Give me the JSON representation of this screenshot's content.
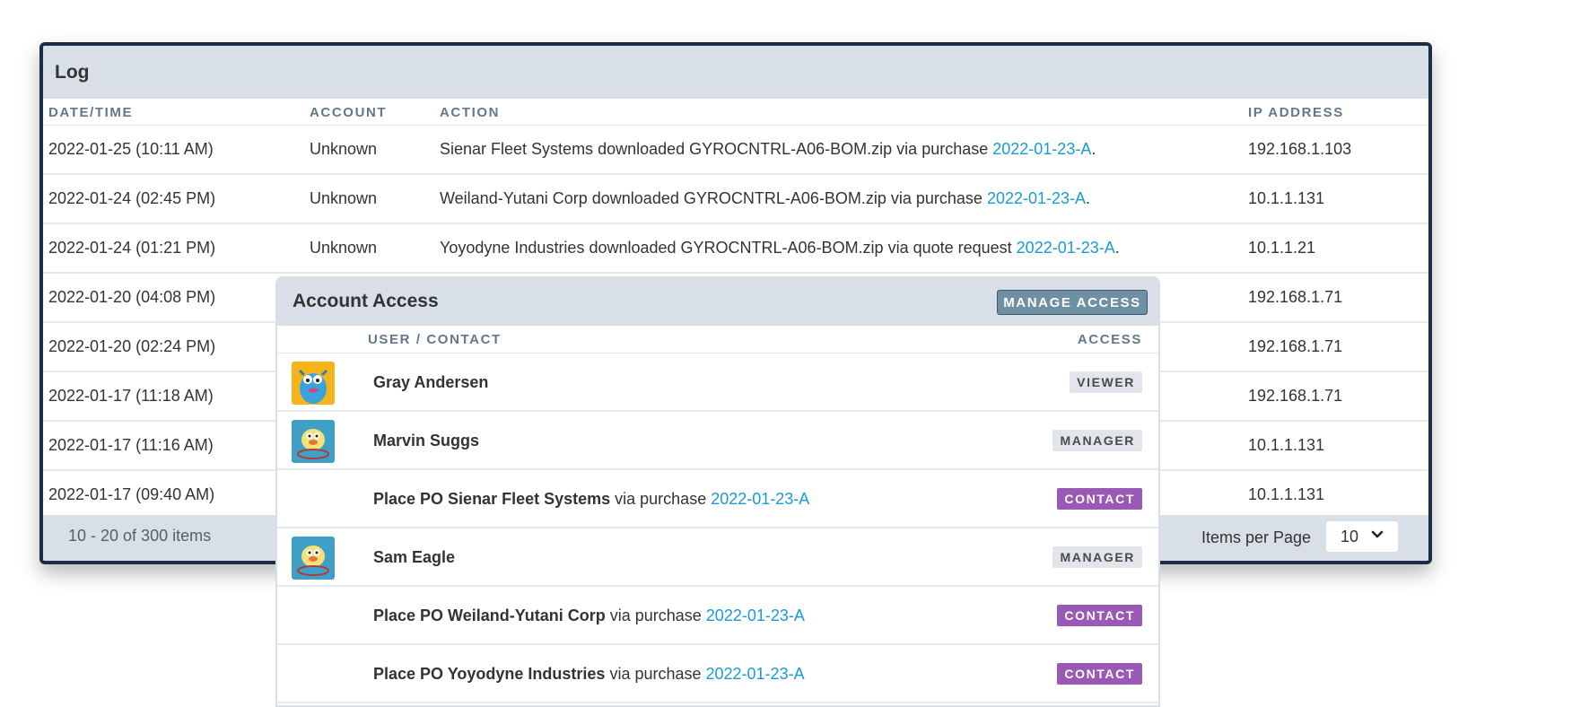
{
  "log": {
    "title": "Log",
    "columns": {
      "datetime": "DATE/TIME",
      "account": "ACCOUNT",
      "action": "ACTION",
      "ip": "IP ADDRESS"
    },
    "rows": [
      {
        "datetime": "2022-01-25 (10:11 AM)",
        "account": "Unknown",
        "action_text": "Sienar Fleet Systems downloaded GYROCNTRL-A06-BOM.zip via purchase ",
        "action_link": "2022-01-23-A",
        "action_tail": ".",
        "ip": "192.168.1.103"
      },
      {
        "datetime": "2022-01-24 (02:45 PM)",
        "account": "Unknown",
        "action_text": "Weiland-Yutani Corp downloaded GYROCNTRL-A06-BOM.zip via purchase ",
        "action_link": "2022-01-23-A",
        "action_tail": ".",
        "ip": "10.1.1.131"
      },
      {
        "datetime": "2022-01-24 (01:21 PM)",
        "account": "Unknown",
        "action_text": "Yoyodyne Industries downloaded GYROCNTRL-A06-BOM.zip via quote request ",
        "action_link": "2022-01-23-A",
        "action_tail": ".",
        "ip": "10.1.1.21"
      },
      {
        "datetime": "2022-01-20 (04:08 PM)",
        "ip": "192.168.1.71"
      },
      {
        "datetime": "2022-01-20 (02:24 PM)",
        "ip": "192.168.1.71"
      },
      {
        "datetime": "2022-01-17 (11:18 AM)",
        "ip": "192.168.1.71"
      },
      {
        "datetime": "2022-01-17 (11:16 AM)",
        "ip": "10.1.1.131"
      },
      {
        "datetime": "2022-01-17 (09:40 AM)",
        "ip": "10.1.1.131"
      }
    ],
    "footer": {
      "count_text": "10 - 20 of 300 items",
      "items_per_page_label": "Items per Page",
      "items_per_page_value": "10"
    }
  },
  "access": {
    "title": "Account Access",
    "manage_button": "MANAGE ACCESS",
    "columns": {
      "user": "USER / CONTACT",
      "access": "ACCESS"
    },
    "rows": [
      {
        "avatar": "blue-monster-avatar",
        "name": "Gray Andersen",
        "badge": "VIEWER",
        "badge_color": "#e2e6ea"
      },
      {
        "avatar": "yellow-creature-avatar",
        "name": "Marvin Suggs",
        "badge": "MANAGER",
        "badge_color": "#e2e6ea"
      },
      {
        "name": "Place PO Sienar Fleet Systems",
        "via": " via purchase ",
        "link": "2022-01-23-A",
        "badge": "CONTACT",
        "badge_color": "#9b59b6"
      },
      {
        "avatar": "yellow-creature-avatar",
        "name": "Sam Eagle",
        "badge": "MANAGER",
        "badge_color": "#e2e6ea"
      },
      {
        "name": "Place PO Weiland-Yutani Corp",
        "via": " via purchase ",
        "link": "2022-01-23-A",
        "badge": "CONTACT",
        "badge_color": "#9b59b6"
      },
      {
        "name": "Place PO Yoyodyne Industries",
        "via": " via purchase ",
        "link": "2022-01-23-A",
        "badge": "CONTACT",
        "badge_color": "#9b59b6"
      }
    ]
  },
  "colors": {
    "panel_header": "#d8dfe6",
    "link": "#1a9bd3",
    "border_dark": "#1f2d44",
    "contact_badge": "#9b59b6",
    "manage_button": "#6f8fa3"
  }
}
